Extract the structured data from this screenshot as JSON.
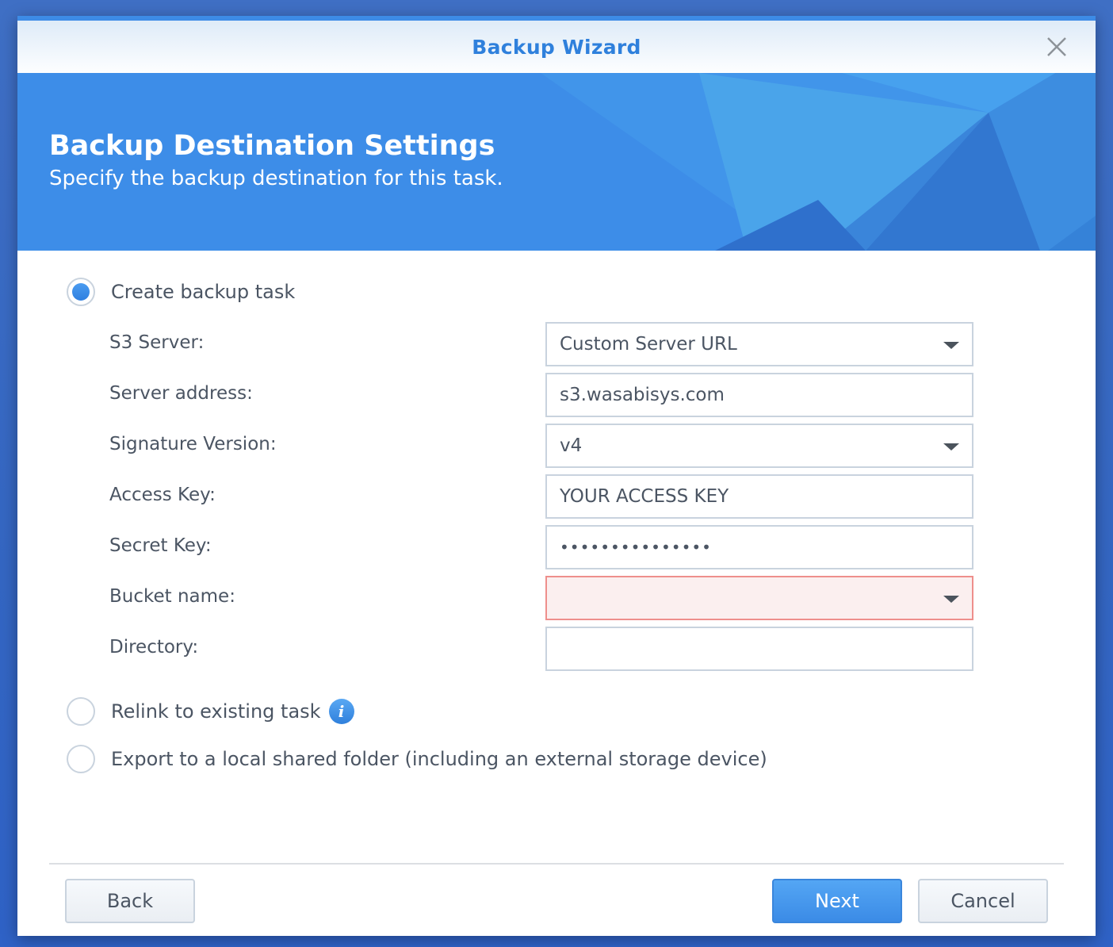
{
  "window": {
    "title": "Backup Wizard",
    "close_icon": "close-icon"
  },
  "banner": {
    "heading": "Backup Destination Settings",
    "subheading": "Specify the backup destination for this task."
  },
  "options": [
    {
      "label": "Create backup task",
      "selected": true
    },
    {
      "label": "Relink to existing task",
      "selected": false,
      "icon": "info-icon"
    },
    {
      "label": "Export to a local shared folder (including an external storage device)",
      "selected": false
    }
  ],
  "form": {
    "s3_server": {
      "label": "S3 Server:",
      "value": "Custom Server URL"
    },
    "server_address": {
      "label": "Server address:",
      "value": "s3.wasabisys.com"
    },
    "signature_version": {
      "label": "Signature Version:",
      "value": "v4"
    },
    "access_key": {
      "label": "Access Key:",
      "value": "YOUR ACCESS KEY"
    },
    "secret_key": {
      "label": "Secret Key:",
      "value": "•••••••••••••••"
    },
    "bucket_name": {
      "label": "Bucket name:",
      "value": "",
      "state": "error"
    },
    "directory": {
      "label": "Directory:",
      "value": ""
    }
  },
  "footer": {
    "back_label": "Back",
    "next_label": "Next",
    "cancel_label": "Cancel"
  },
  "colors": {
    "accent": "#3d8be6",
    "title_text": "#2f80dc",
    "error_border": "#ee8f8c",
    "error_bg": "#fbefef"
  }
}
